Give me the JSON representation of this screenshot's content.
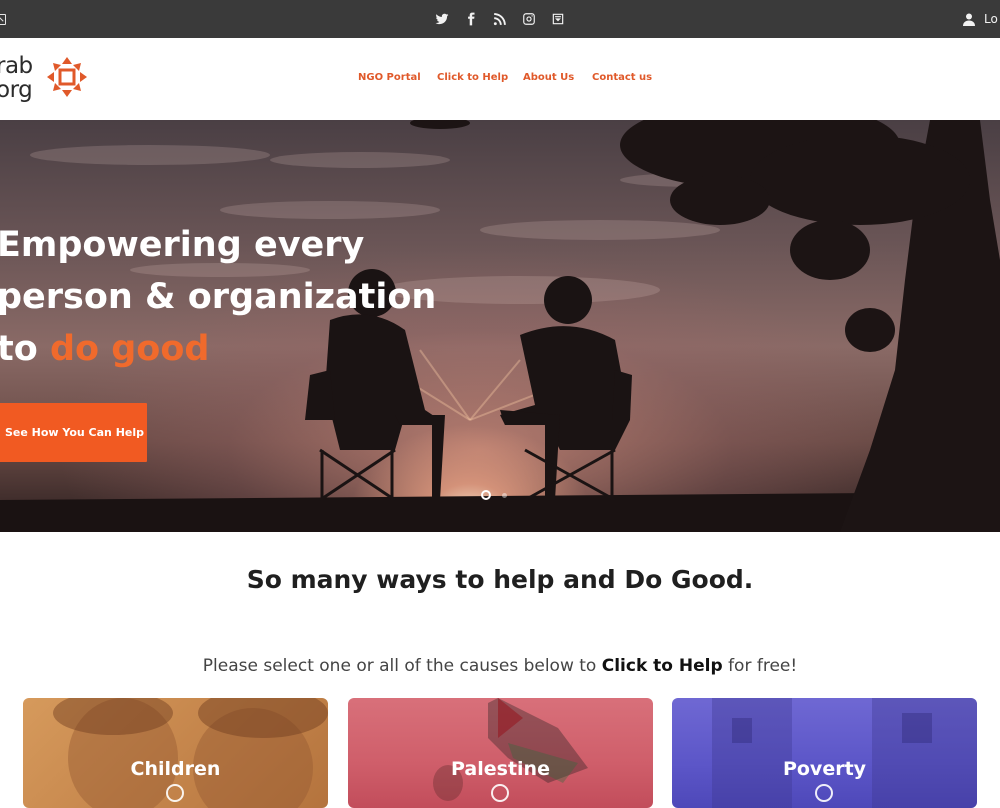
{
  "topbar": {
    "social_icons": [
      "twitter-icon",
      "facebook-icon",
      "rss-icon",
      "instagram-icon",
      "newsletter-icon"
    ],
    "login_label": "Lo"
  },
  "header": {
    "logo_line1": "rab",
    "logo_line2": "org",
    "nav": [
      {
        "label": "NGO Portal"
      },
      {
        "label": "Click to Help"
      },
      {
        "label": "About Us"
      },
      {
        "label": "Contact us"
      }
    ]
  },
  "hero": {
    "title_line1": "Empowering every",
    "title_line2": "person & organization",
    "title_line3_prefix": "to ",
    "title_line3_accent": "do good",
    "cta_label": "See How You Can Help",
    "slides_total": 2,
    "active_slide": 1
  },
  "section": {
    "title": "So many ways to help and Do Good.",
    "subtitle_prefix": "Please select one or all of the causes below to ",
    "subtitle_bold": "Click to Help",
    "subtitle_suffix": " for free!"
  },
  "causes": [
    {
      "label": "Children"
    },
    {
      "label": "Palestine"
    },
    {
      "label": "Poverty"
    }
  ],
  "colors": {
    "accent": "#f15a22",
    "topbar": "#3a3a3a",
    "nav_link": "#e0592a"
  }
}
